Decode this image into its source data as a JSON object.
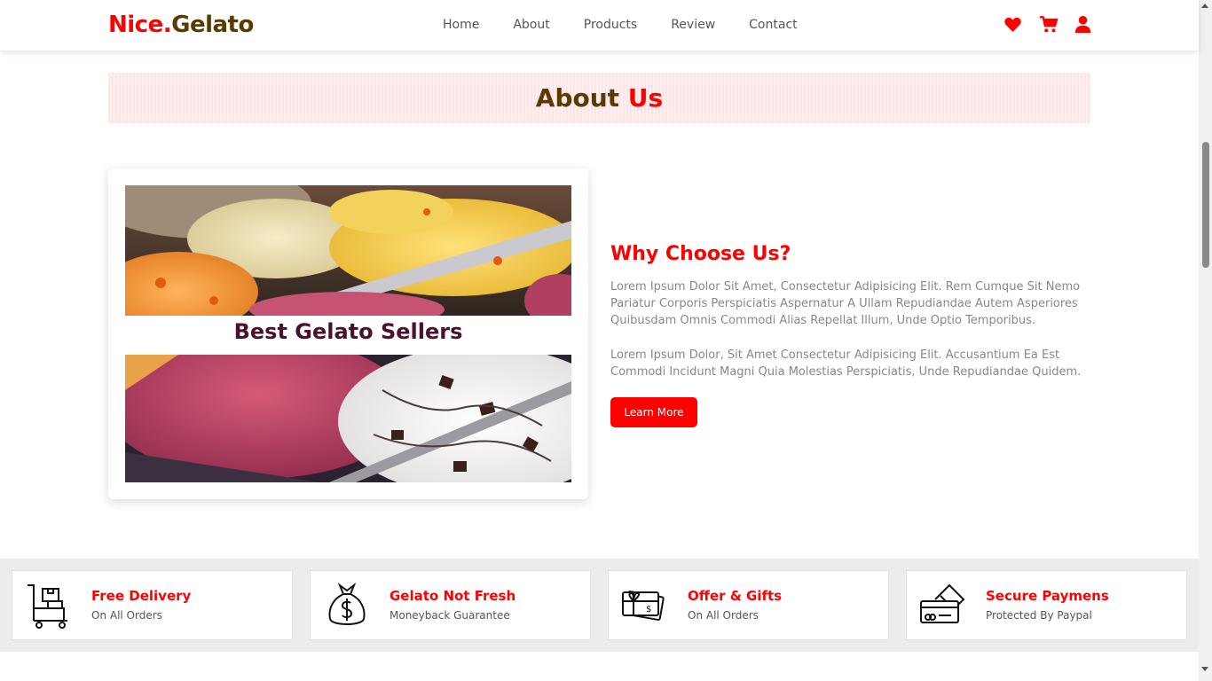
{
  "header": {
    "logo_part1": "Nice.",
    "logo_part2": "Gelato",
    "nav": [
      "Home",
      "About",
      "Products",
      "Review",
      "Contact"
    ],
    "icons": [
      "heart-icon",
      "cart-icon",
      "user-icon"
    ]
  },
  "about": {
    "title_part1": "About ",
    "title_part2": "Us"
  },
  "image_card": {
    "caption": "Best Gelato Sellers"
  },
  "why": {
    "title": "Why Choose Us?",
    "paragraph1": "Lorem Ipsum Dolor Sit Amet, Consectetur Adipisicing Elit. Rem Cumque Sit Nemo Pariatur Corporis Perspiciatis Aspernatur A Ullam Repudiandae Autem Asperiores Quibusdam Omnis Commodi Alias Repellat Illum, Unde Optio Temporibus.",
    "paragraph2": "Lorem Ipsum Dolor, Sit Amet Consectetur Adipisicing Elit. Accusantium Ea Est Commodi Incidunt Magni Quia Molestias Perspiciatis, Unde Repudiandae Quidem.",
    "button": "Learn More"
  },
  "features": [
    {
      "title": "Free Delivery",
      "subtitle": "On All Orders",
      "icon": "delivery-cart-icon"
    },
    {
      "title": "Gelato Not Fresh",
      "subtitle": "Moneyback Guarantee",
      "icon": "money-bag-icon"
    },
    {
      "title": "Offer & Gifts",
      "subtitle": "On All Orders",
      "icon": "gift-card-icon"
    },
    {
      "title": "Secure Paymens",
      "subtitle": "Protected By Paypal",
      "icon": "credit-card-icon"
    }
  ],
  "colors": {
    "accent": "#ff0000",
    "brown": "#5b3a00",
    "banner_bg": "#fde4e6",
    "features_bg": "#ececec"
  }
}
